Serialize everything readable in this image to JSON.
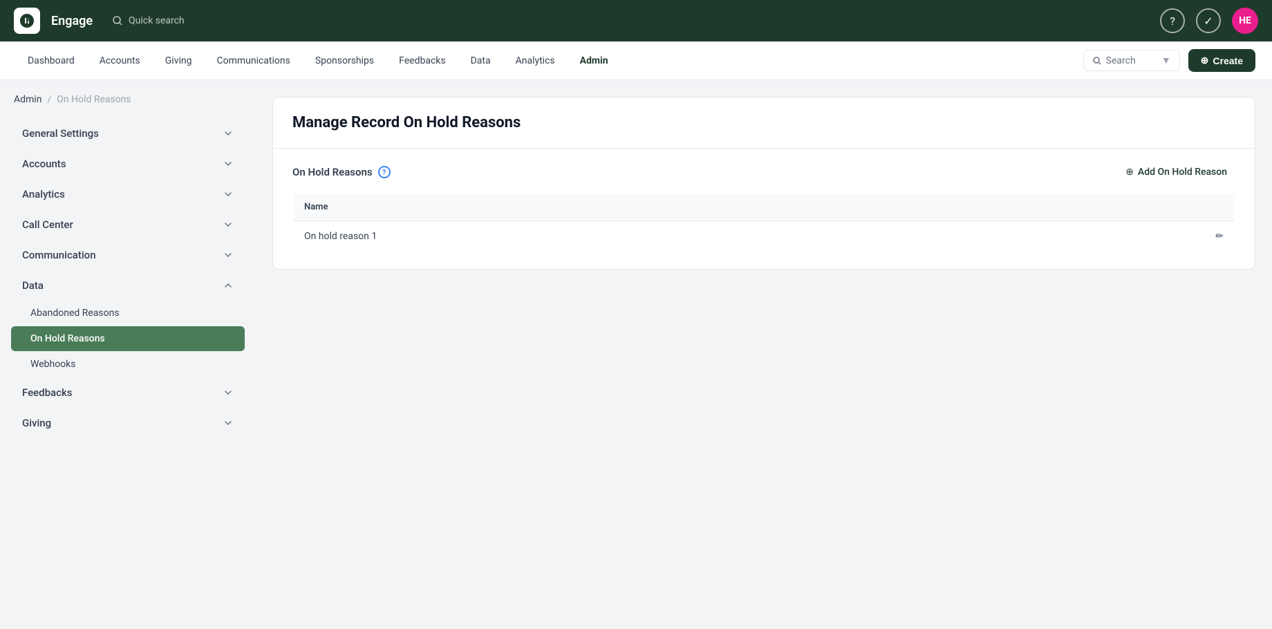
{
  "app": {
    "name": "Engage",
    "logo_alt": "engage-logo"
  },
  "topbar": {
    "search_placeholder": "Quick search",
    "avatar_initials": "HE",
    "help_label": "help",
    "tasks_label": "tasks"
  },
  "navbar": {
    "items": [
      {
        "label": "Dashboard",
        "active": false
      },
      {
        "label": "Accounts",
        "active": false
      },
      {
        "label": "Giving",
        "active": false
      },
      {
        "label": "Communications",
        "active": false
      },
      {
        "label": "Sponsorships",
        "active": false
      },
      {
        "label": "Feedbacks",
        "active": false
      },
      {
        "label": "Data",
        "active": false
      },
      {
        "label": "Analytics",
        "active": false
      },
      {
        "label": "Admin",
        "active": true
      }
    ],
    "search_label": "Search",
    "create_label": "Create"
  },
  "breadcrumb": {
    "parent": "Admin",
    "current": "On Hold Reasons"
  },
  "sidebar": {
    "sections": [
      {
        "label": "General Settings",
        "expanded": false,
        "children": []
      },
      {
        "label": "Accounts",
        "expanded": false,
        "children": []
      },
      {
        "label": "Analytics",
        "expanded": false,
        "children": []
      },
      {
        "label": "Call Center",
        "expanded": false,
        "children": []
      },
      {
        "label": "Communication",
        "expanded": false,
        "children": []
      },
      {
        "label": "Data",
        "expanded": true,
        "children": [
          {
            "label": "Abandoned Reasons",
            "active": false
          },
          {
            "label": "On Hold Reasons",
            "active": true
          },
          {
            "label": "Webhooks",
            "active": false
          }
        ]
      },
      {
        "label": "Feedbacks",
        "expanded": false,
        "children": []
      },
      {
        "label": "Giving",
        "expanded": false,
        "children": []
      }
    ]
  },
  "main": {
    "title": "Manage Record On Hold Reasons",
    "section_title": "On Hold Reasons",
    "add_button_label": "Add On Hold Reason",
    "table": {
      "columns": [
        "Name"
      ],
      "rows": [
        {
          "name": "On hold reason 1"
        }
      ]
    }
  }
}
